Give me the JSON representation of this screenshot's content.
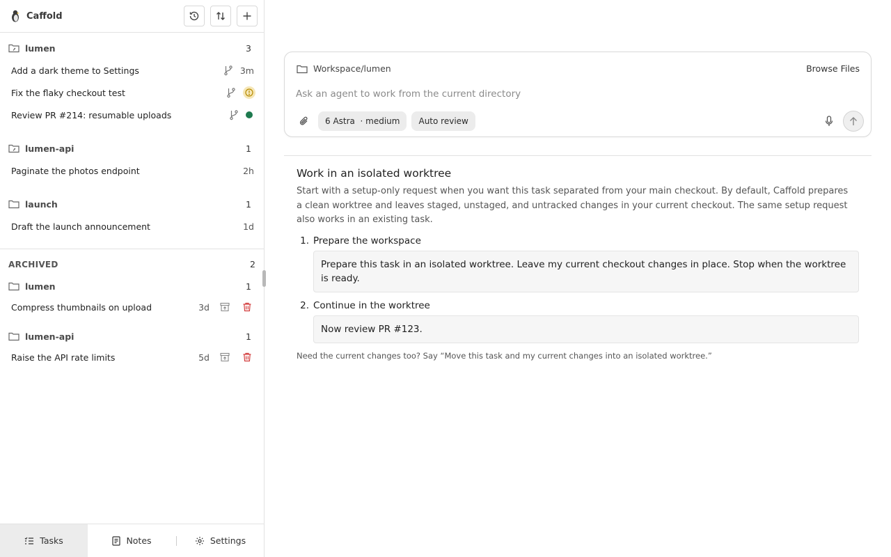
{
  "app": {
    "name": "Caffold"
  },
  "sidebar": {
    "groups": [
      {
        "name": "lumen",
        "count": "3",
        "tasks": [
          {
            "title": "Add a dark theme to Settings",
            "age": "3m",
            "status": ""
          },
          {
            "title": "Fix the flaky checkout test",
            "age": "",
            "status": "warning"
          },
          {
            "title": "Review PR #214: resumable uploads",
            "age": "",
            "status": "done"
          }
        ]
      },
      {
        "name": "lumen-api",
        "count": "1",
        "tasks": [
          {
            "title": "Paginate the photos endpoint",
            "age": "2h"
          }
        ]
      },
      {
        "name": "launch",
        "count": "1",
        "tasks": [
          {
            "title": "Draft the launch announcement",
            "age": "1d"
          }
        ]
      }
    ],
    "archived": {
      "label": "ARCHIVED",
      "count": "2",
      "groups": [
        {
          "name": "lumen",
          "count": "1",
          "tasks": [
            {
              "title": "Compress thumbnails on upload",
              "age": "3d"
            }
          ]
        },
        {
          "name": "lumen-api",
          "count": "1",
          "tasks": [
            {
              "title": "Raise the API rate limits",
              "age": "5d"
            }
          ]
        }
      ]
    },
    "nav": [
      {
        "label": "Tasks",
        "icon": "tasks-icon",
        "active": true
      },
      {
        "label": "Notes",
        "icon": "notes-icon"
      },
      {
        "label": "Settings",
        "icon": "gear-icon"
      }
    ]
  },
  "composer": {
    "path": "Workspace/lumen",
    "browse_label": "Browse Files",
    "placeholder": "Ask an agent to work from the current directory",
    "model_chip": "6 Astra  · medium",
    "review_chip": "Auto review"
  },
  "guide": {
    "title": "Work in an isolated worktree",
    "body": "Start with a setup-only request when you want this task separated from your main checkout. By default, Caffold prepares a clean worktree and leaves staged, unstaged, and untracked changes in your current checkout. The same setup request also works in an existing task.",
    "steps": [
      {
        "num": "1.",
        "title": "Prepare the workspace",
        "prompt": "Prepare this task in an isolated worktree. Leave my current checkout changes in place. Stop when the worktree is ready."
      },
      {
        "num": "2.",
        "title": "Continue in the worktree",
        "prompt": "Now review PR #123."
      }
    ],
    "footer": "Need the current changes too? Say “Move this task and my current changes into an isolated worktree.”"
  },
  "colors": {
    "accent_green": "#1e7a4f",
    "warning": "#d9a400",
    "delete": "#d23b3b"
  }
}
